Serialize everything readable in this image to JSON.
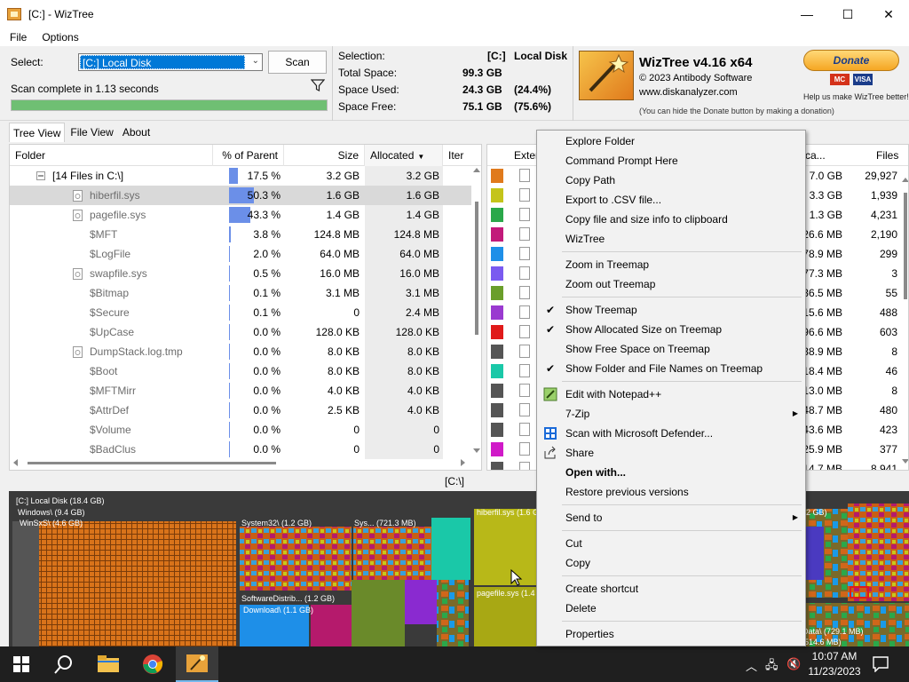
{
  "window": {
    "title": "[C:]  - WizTree",
    "minimize": "—",
    "maximize": "☐",
    "close": "✕"
  },
  "menu": [
    "File",
    "Options"
  ],
  "select_label": "Select:",
  "drive_value": "[C:] Local Disk",
  "scan_button": "Scan",
  "scan_status": "Scan complete in 1.13 seconds",
  "progress_fraction": 1.0,
  "stats": {
    "selection_label": "Selection:",
    "selection_drive": "[C:]",
    "selection_name": "Local Disk",
    "total_label": "Total Space:",
    "total_value": "99.3 GB",
    "used_label": "Space Used:",
    "used_value": "24.3 GB",
    "used_pct": "(24.4%)",
    "free_label": "Space Free:",
    "free_value": "75.1 GB",
    "free_pct": "(75.6%)"
  },
  "branding": {
    "name": "WizTree v4.16 x64",
    "copyright": "© 2023 Antibody Software",
    "url": "www.diskanalyzer.com",
    "note": "(You can hide the Donate button by making a donation)",
    "donate_button": "Donate",
    "card1": "MC",
    "card2": "VISA",
    "donate_sub": "Help us make WizTree better!"
  },
  "tabs": [
    "Tree View",
    "File View",
    "About"
  ],
  "tree_headers": {
    "folder": "Folder",
    "pct": "% of Parent",
    "size": "Size",
    "allocated": "Allocated",
    "items": "Iter"
  },
  "tree_rows": [
    {
      "name": "[14 Files in C:\\]",
      "pct": "17.5 %",
      "pct_value": 17.5,
      "size": "3.2 GB",
      "alloc": "3.2 GB"
    },
    {
      "name": "hiberfil.sys",
      "pct": "50.3 %",
      "pct_value": 50.3,
      "size": "1.6 GB",
      "alloc": "1.6 GB"
    },
    {
      "name": "pagefile.sys",
      "pct": "43.3 %",
      "pct_value": 43.3,
      "size": "1.4 GB",
      "alloc": "1.4 GB"
    },
    {
      "name": "$MFT",
      "pct": "3.8 %",
      "pct_value": 3.8,
      "size": "124.8 MB",
      "alloc": "124.8 MB"
    },
    {
      "name": "$LogFile",
      "pct": "2.0 %",
      "pct_value": 2.0,
      "size": "64.0 MB",
      "alloc": "64.0 MB"
    },
    {
      "name": "swapfile.sys",
      "pct": "0.5 %",
      "pct_value": 0.5,
      "size": "16.0 MB",
      "alloc": "16.0 MB"
    },
    {
      "name": "$Bitmap",
      "pct": "0.1 %",
      "pct_value": 0.1,
      "size": "3.1 MB",
      "alloc": "3.1 MB"
    },
    {
      "name": "$Secure",
      "pct": "0.1 %",
      "pct_value": 0.1,
      "size": "0",
      "alloc": "2.4 MB"
    },
    {
      "name": "$UpCase",
      "pct": "0.0 %",
      "pct_value": 0.0,
      "size": "128.0 KB",
      "alloc": "128.0 KB"
    },
    {
      "name": "DumpStack.log.tmp",
      "pct": "0.0 %",
      "pct_value": 0.0,
      "size": "8.0 KB",
      "alloc": "8.0 KB"
    },
    {
      "name": "$Boot",
      "pct": "0.0 %",
      "pct_value": 0.0,
      "size": "8.0 KB",
      "alloc": "8.0 KB"
    },
    {
      "name": "$MFTMirr",
      "pct": "0.0 %",
      "pct_value": 0.0,
      "size": "4.0 KB",
      "alloc": "4.0 KB"
    },
    {
      "name": "$AttrDef",
      "pct": "0.0 %",
      "pct_value": 0.0,
      "size": "2.5 KB",
      "alloc": "4.0 KB"
    },
    {
      "name": "$Volume",
      "pct": "0.0 %",
      "pct_value": 0.0,
      "size": "0",
      "alloc": "0"
    },
    {
      "name": "$BadClus",
      "pct": "0.0 %",
      "pct_value": 0.0,
      "size": "0",
      "alloc": "0"
    }
  ],
  "ext_headers": {
    "ext": "Exter",
    "alloc": "ca...",
    "files": "Files"
  },
  "ext_rows": [
    {
      "color": "#e07a1c",
      "alloc": "7.0 GB",
      "files": "29,927"
    },
    {
      "color": "#c4c41a",
      "alloc": "3.3 GB",
      "files": "1,939"
    },
    {
      "color": "#2aa84a",
      "alloc": "1.3 GB",
      "files": "4,231"
    },
    {
      "color": "#c21a7a",
      "alloc": "26.6 MB",
      "files": "2,190"
    },
    {
      "color": "#1e8fe8",
      "alloc": "78.9 MB",
      "files": "299"
    },
    {
      "color": "#7a5af0",
      "alloc": "77.3 MB",
      "files": "3"
    },
    {
      "color": "#6a9e2a",
      "alloc": "36.5 MB",
      "files": "55"
    },
    {
      "color": "#9a3ad0",
      "alloc": "15.6 MB",
      "files": "488"
    },
    {
      "color": "#e01a1a",
      "alloc": "96.6 MB",
      "files": "603"
    },
    {
      "color": "#555555",
      "alloc": "38.9 MB",
      "files": "8"
    },
    {
      "color": "#1ac8a8",
      "alloc": "18.4 MB",
      "files": "46"
    },
    {
      "color": "#555555",
      "alloc": "13.0 MB",
      "files": "8"
    },
    {
      "color": "#555555",
      "alloc": "48.7 MB",
      "files": "480"
    },
    {
      "color": "#555555",
      "alloc": "43.6 MB",
      "files": "423"
    },
    {
      "color": "#d01ac8",
      "alloc": "25.9 MB",
      "files": "377"
    },
    {
      "color": "#555555",
      "alloc": "14.7 MB",
      "files": "8,941"
    }
  ],
  "path_bar": "[C:\\]",
  "treemap_labels": {
    "root": "[C:] Local Disk (18.4 GB)",
    "windows": "Windows\\ (9.4 GB)",
    "winsxs": "WinSxS\\ (4.6 GB)",
    "system32": "System32\\ (1.2 GB)",
    "sys": "Sys... (721.3 MB)",
    "hiberfil": "hiberfil.sys (1.6 G",
    "pagefile": "pagefile.sys (1.4",
    "softdist": "SoftwareDistrib... (1.2 GB)",
    "download": "Download\\ (1.1 GB)",
    "right1": "2 GB)",
    "data": "Data\\ (729.1 MB)",
    "right2": "514.6 MB)"
  },
  "context_menu": [
    {
      "label": "Explore Folder"
    },
    {
      "label": "Command Prompt Here"
    },
    {
      "label": "Copy Path"
    },
    {
      "label": "Export to .CSV file..."
    },
    {
      "label": "Copy file and size info to clipboard"
    },
    {
      "label": "WizTree"
    },
    {
      "sep": true
    },
    {
      "label": "Zoom in Treemap"
    },
    {
      "label": "Zoom out Treemap"
    },
    {
      "sep": true
    },
    {
      "label": "Show Treemap",
      "checked": true
    },
    {
      "label": "Show Allocated Size on Treemap",
      "checked": true
    },
    {
      "label": "Show Free Space on Treemap"
    },
    {
      "label": "Show Folder and File Names on Treemap",
      "checked": true
    },
    {
      "sep": true
    },
    {
      "label": "Edit with Notepad++",
      "icon": "notepadpp"
    },
    {
      "label": "7-Zip",
      "submenu": true
    },
    {
      "label": "Scan with Microsoft Defender...",
      "icon": "defender"
    },
    {
      "label": "Share",
      "icon": "share"
    },
    {
      "label": "Open with...",
      "bold": true
    },
    {
      "label": "Restore previous versions"
    },
    {
      "sep": true
    },
    {
      "label": "Send to",
      "submenu": true
    },
    {
      "sep": true
    },
    {
      "label": "Cut"
    },
    {
      "label": "Copy"
    },
    {
      "sep": true
    },
    {
      "label": "Create shortcut"
    },
    {
      "label": "Delete"
    },
    {
      "sep": true
    },
    {
      "label": "Properties"
    }
  ],
  "taskbar": {
    "time": "10:07 AM",
    "date": "11/23/2023"
  }
}
